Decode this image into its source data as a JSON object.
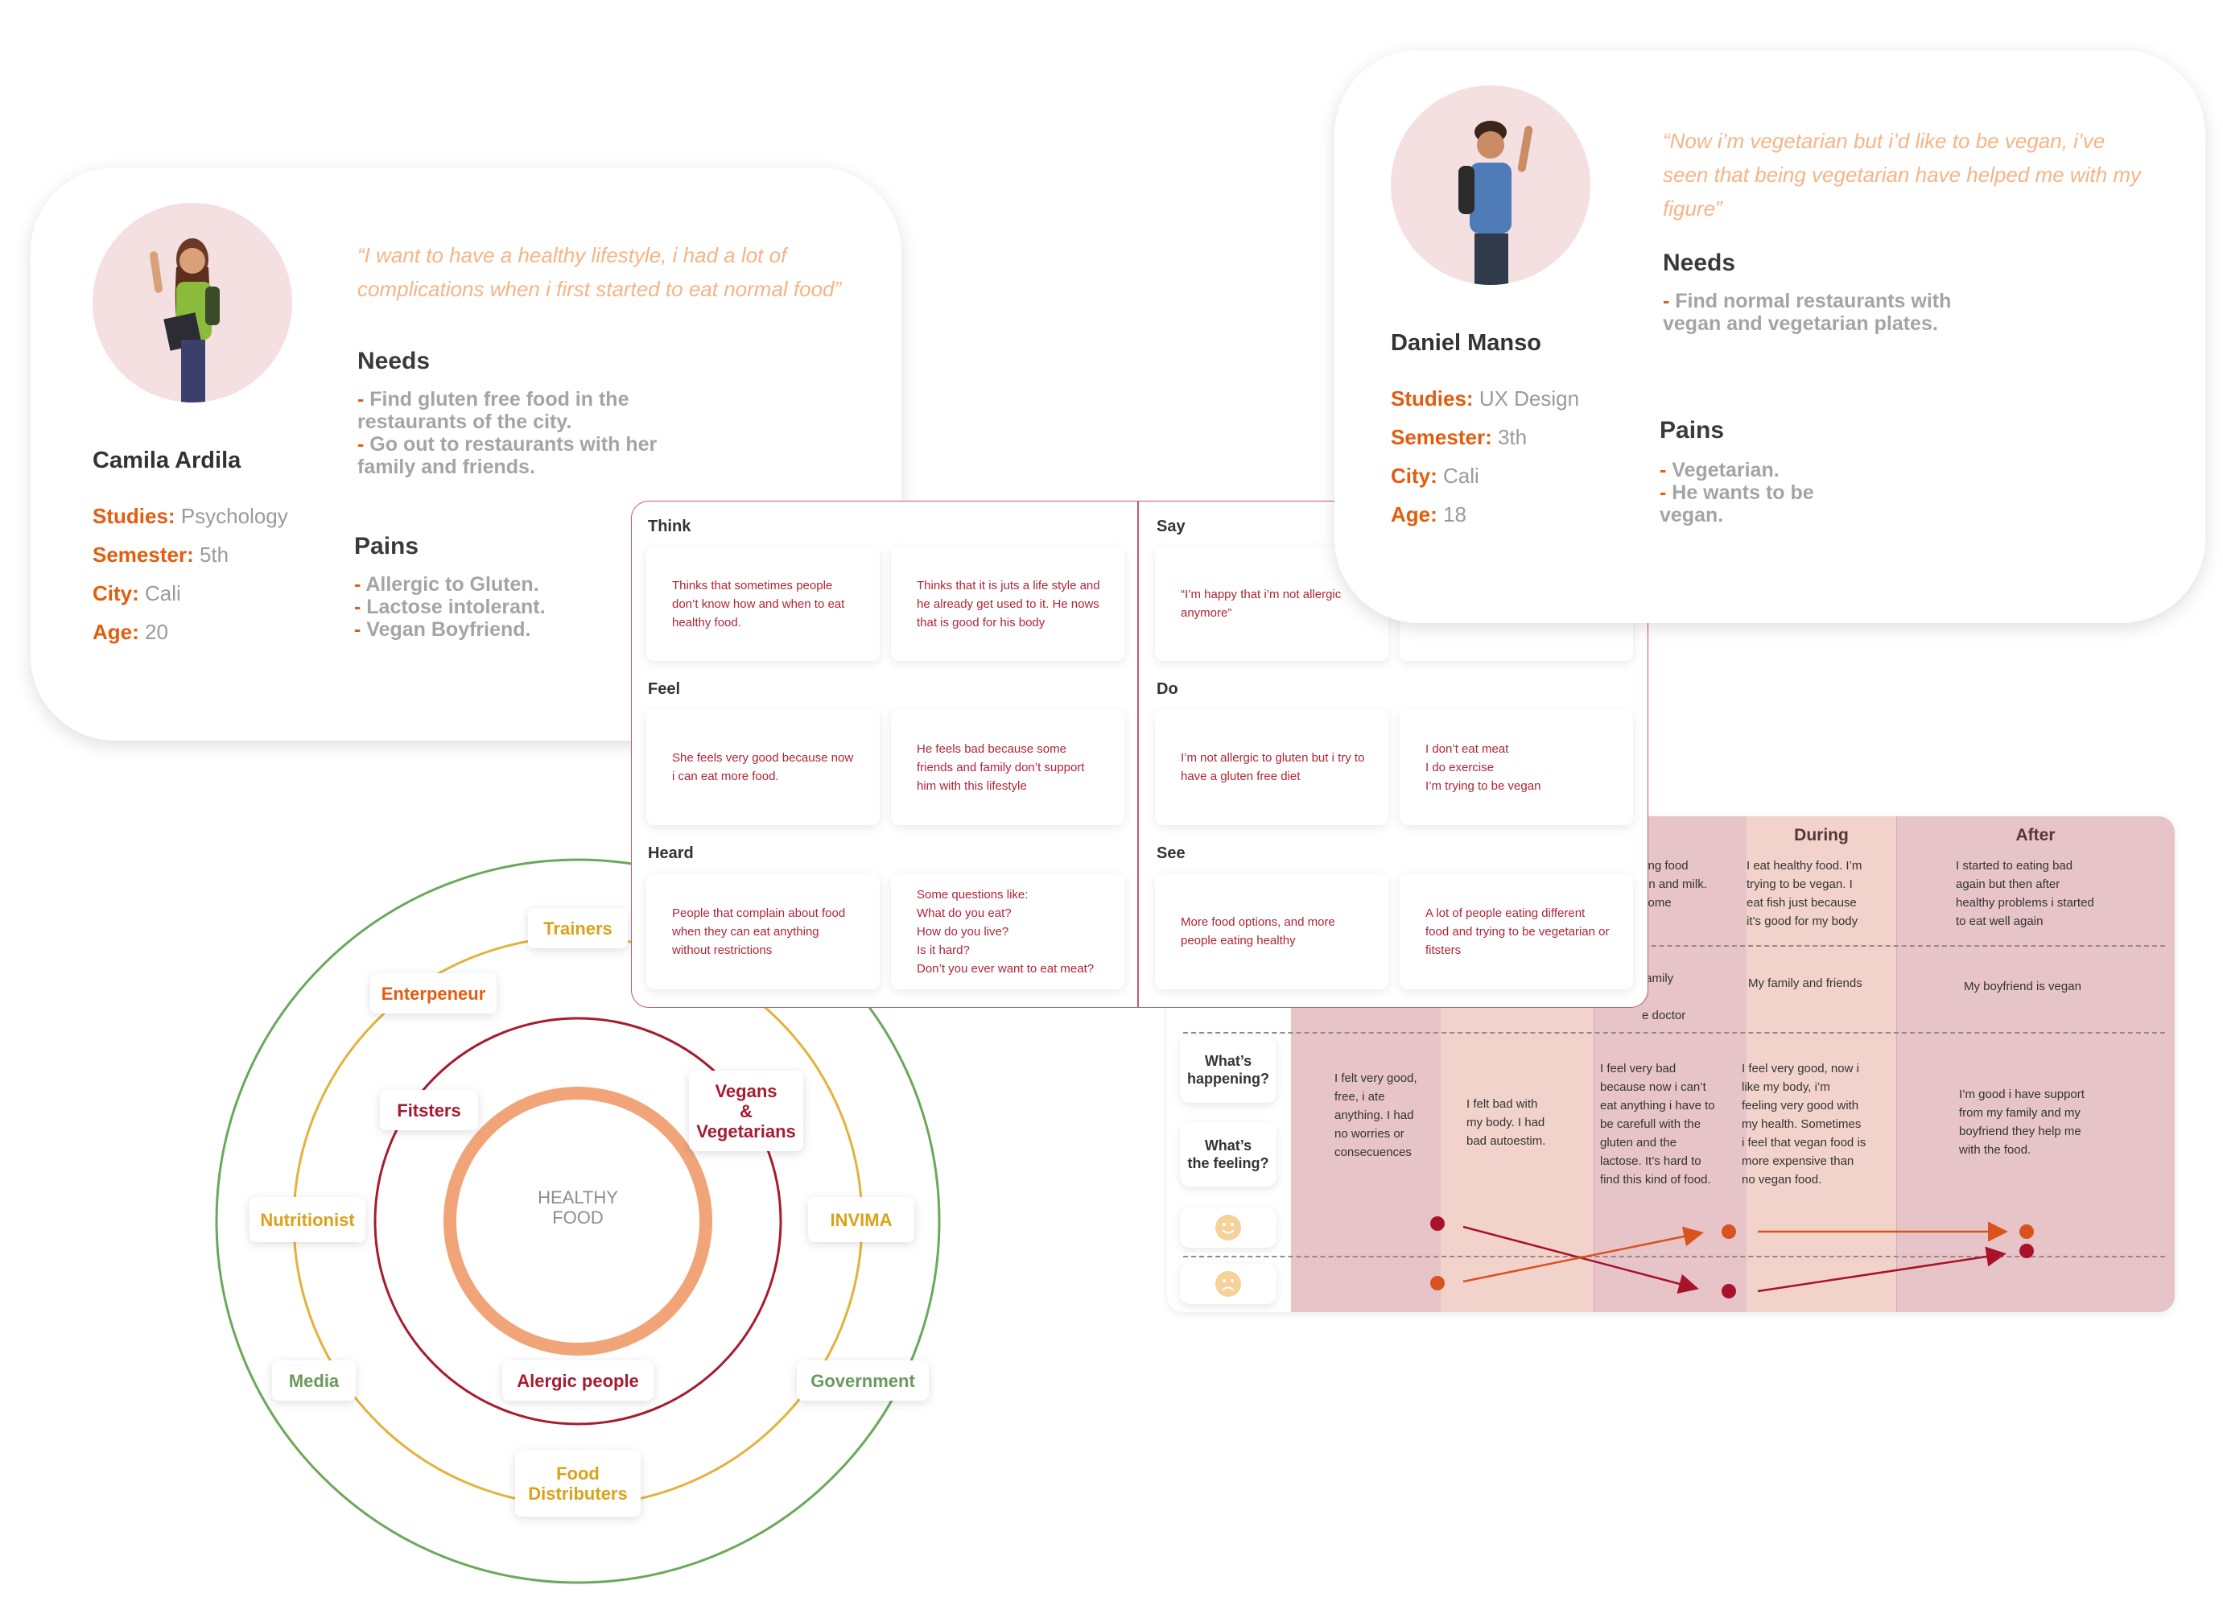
{
  "persona1": {
    "quote": "“I want to have a healthy lifestyle, i had a lot of complications when i first started to eat normal food”",
    "name": "Camila Ardila",
    "studies_label": "Studies:",
    "studies": "Psychology",
    "semester_label": "Semester:",
    "semester": "5th",
    "city_label": "City:",
    "city": "Cali",
    "age_label": "Age:",
    "age": "20",
    "needs_title": "Needs",
    "needs": [
      "Find gluten free food in the restaurants of the city.",
      "Go out to restaurants with her family and friends."
    ],
    "pains_title": "Pains",
    "pains": [
      "Allergic to Gluten.",
      "Lactose intolerant.",
      "Vegan Boyfriend."
    ]
  },
  "persona2": {
    "quote": "“Now i’m vegetarian but i’d like to be vegan, i’ve seen that being vegetarian have helped me with my figure”",
    "name": "Daniel Manso",
    "studies_label": "Studies:",
    "studies": "UX Design",
    "semester_label": "Semester:",
    "semester": "3th",
    "city_label": "City:",
    "city": "Cali",
    "age_label": "Age:",
    "age": "18",
    "needs_title": "Needs",
    "needs": [
      "Find normal restaurants with vegan and vegetarian plates."
    ],
    "pains_title": "Pains",
    "pains": [
      "Vegetarian.",
      "He wants to be vegan."
    ]
  },
  "empathy": {
    "think_title": "Think",
    "think": [
      "Thinks that sometimes people don’t know how and when to eat healthy food.",
      "Thinks that it is juts a life style and he already get used to it. He nows that is good for his body"
    ],
    "say_title": "Say",
    "say": [
      "“I’m happy that i’m not allergic anymore”"
    ],
    "feel_title": "Feel",
    "feel": [
      "She feels very good because now i can eat more food.",
      "He feels bad because some friends and family don’t support him with this lifestyle"
    ],
    "do_title": "Do",
    "do": [
      "I’m not allergic to gluten but i try to have a gluten free diet",
      "I don’t  eat meat\nI do exercise\nI’m trying to be vegan"
    ],
    "heard_title": "Heard",
    "heard": [
      "People that complain about food when they can eat anything without restrictions",
      "Some questions like:\nWhat do you eat?\nHow do you live?\nIs it hard?\nDon’t you ever want to eat meat?"
    ],
    "see_title": "See",
    "see": [
      "More food options, and more people eating healthy",
      "A lot of people eating different food and trying to be vegetarian or fitsters"
    ]
  },
  "journey": {
    "during_title": "During",
    "after_title": "After",
    "row1": [
      "ting food\nen and milk.\n some",
      "I eat healthy food. I’m\ntrying to be vegan. I\neat fish just because\nit’s good for my body",
      "I started to eating bad\nagain but then after\nhealthy problems i started\nto eat well again"
    ],
    "row2": [
      " family\n\ne doctor",
      "My family and friends",
      "My boyfriend is vegan"
    ],
    "label_happening": "What’s\nhappening?",
    "label_feeling": "What’s\nthe feeling?",
    "row3": [
      "I felt very good,\nfree, i ate\nanything. I had\nno worries or\nconsecuences",
      "I felt bad with\nmy body. I had\nbad autoestim.",
      "I feel very bad\nbecause now i can’t\neat anything i have to\nbe carefull with the\ngluten and the\nlactose. It’s hard to\nfind this kind of food.",
      "I feel very good, now i\nlike my body, i’m\nfeeling very good with\nmy health. Sometimes\ni feel that vegan food is\nmore expensive than\nno vegan food.",
      "I’m good i have support\nfrom my family and my\nboyfriend they help me\nwith the food."
    ],
    "happy_icon": "smiley-icon",
    "sad_icon": "sad-face-icon",
    "colors": {
      "panel": "#e7c4c8",
      "light": "#f2d3cc",
      "dot_dark": "#a8122a",
      "dot_orange": "#d9531e"
    }
  },
  "stakeholders": {
    "center": "HEALTHY\nFOOD",
    "labels": {
      "trainers": "Trainers",
      "entrepreneur": "Enterpeneur",
      "fitsters": "Fitsters",
      "vegans": "Vegans\n&\nVegetarians",
      "nutritionist": "Nutritionist",
      "invima": "INVIMA",
      "media": "Media",
      "allergic": "Alergic people",
      "government": "Government",
      "food_distributers": "Food\nDistributers"
    },
    "colors": {
      "outer": "#6aa85a",
      "middle": "#e4b23b",
      "inner": "#a61b30",
      "core": "#f2a479",
      "red_text": "#a61b30",
      "gold_text": "#dba11a",
      "orange_text": "#e35d0f",
      "green_text": "#6a9a5a"
    }
  }
}
